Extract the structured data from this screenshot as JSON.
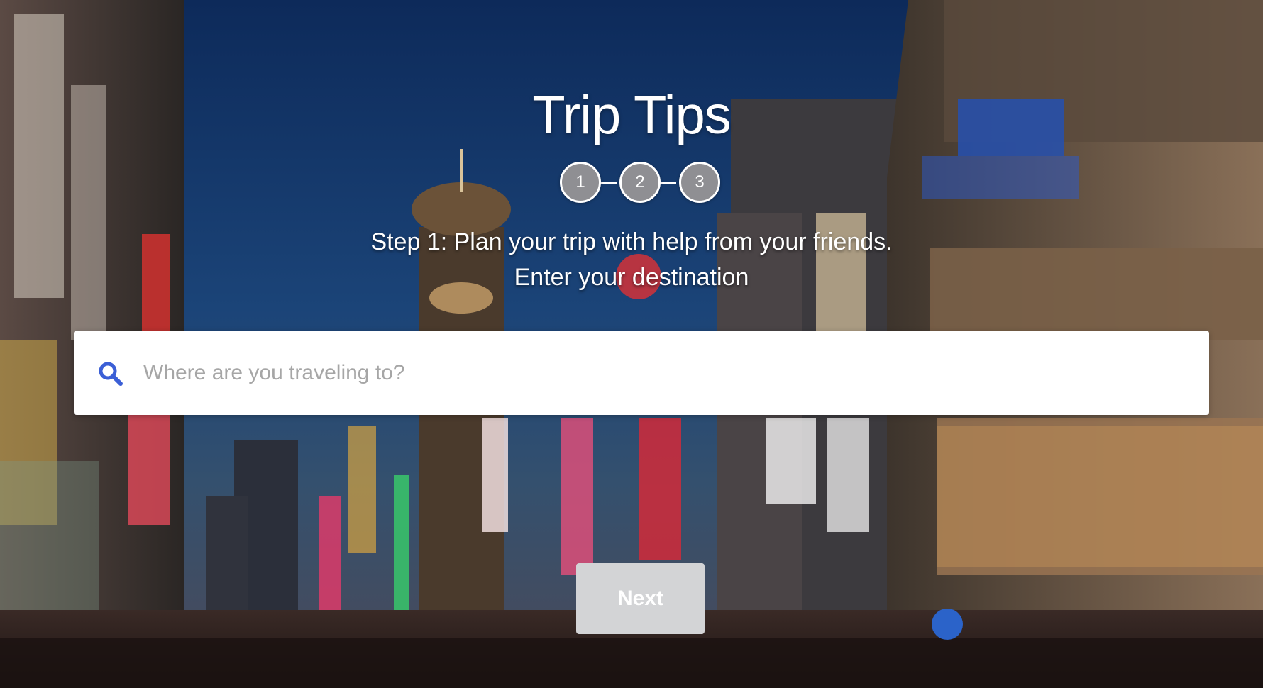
{
  "app": {
    "title": "Trip Tips"
  },
  "stepper": {
    "steps": [
      "1",
      "2",
      "3"
    ]
  },
  "instructions": {
    "line1": "Step 1: Plan your trip with help from your friends.",
    "line2": "Enter your destination"
  },
  "search": {
    "value": "",
    "placeholder": "Where are you traveling to?",
    "icon": "search-icon"
  },
  "actions": {
    "next_label": "Next"
  },
  "colors": {
    "step_fill": "#8f8f93",
    "search_icon": "#3b5fd6",
    "next_button_bg": "#d3d4d6"
  }
}
